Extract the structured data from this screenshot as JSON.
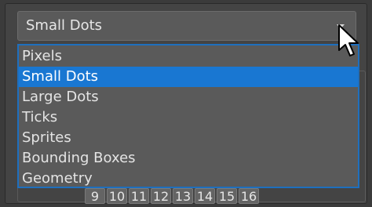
{
  "combo": {
    "selected_value": "Small Dots"
  },
  "dropdown": {
    "options": [
      "Pixels",
      "Small Dots",
      "Large Dots",
      "Ticks",
      "Sprites",
      "Bounding Boxes",
      "Geometry"
    ],
    "selected_index": 1
  },
  "pager": {
    "buttons": [
      "9",
      "10",
      "11",
      "12",
      "13",
      "14",
      "15",
      "16"
    ]
  },
  "colors": {
    "selection": "#1977d2",
    "border_focus": "#1e6fbe",
    "panel": "#444444",
    "combo_bg": "#5a5a5a"
  },
  "icons": {
    "combo_arrow": "dropdown-arrow-icon",
    "cursor": "mouse-pointer-icon"
  }
}
